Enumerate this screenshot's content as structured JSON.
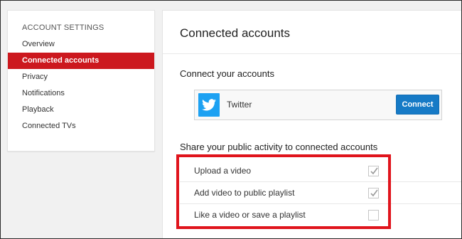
{
  "sidebar": {
    "heading": "ACCOUNT SETTINGS",
    "items": [
      {
        "label": "Overview",
        "active": false
      },
      {
        "label": "Connected accounts",
        "active": true
      },
      {
        "label": "Privacy",
        "active": false
      },
      {
        "label": "Notifications",
        "active": false
      },
      {
        "label": "Playback",
        "active": false
      },
      {
        "label": "Connected TVs",
        "active": false
      }
    ]
  },
  "main": {
    "title": "Connected accounts",
    "connect_section_title": "Connect your accounts",
    "service": {
      "name": "Twitter",
      "icon": "twitter-bird-icon",
      "color": "#1da1f2",
      "button_label": "Connect"
    },
    "share_section_title": "Share your public activity to connected accounts",
    "share_options": [
      {
        "label": "Upload a video",
        "checked": true
      },
      {
        "label": "Add video to public playlist",
        "checked": true
      },
      {
        "label": "Like a video or save a playlist",
        "checked": false
      }
    ]
  },
  "colors": {
    "accent_red": "#cc181e",
    "button_blue": "#167ac6",
    "annotation_red": "#e0141c"
  }
}
